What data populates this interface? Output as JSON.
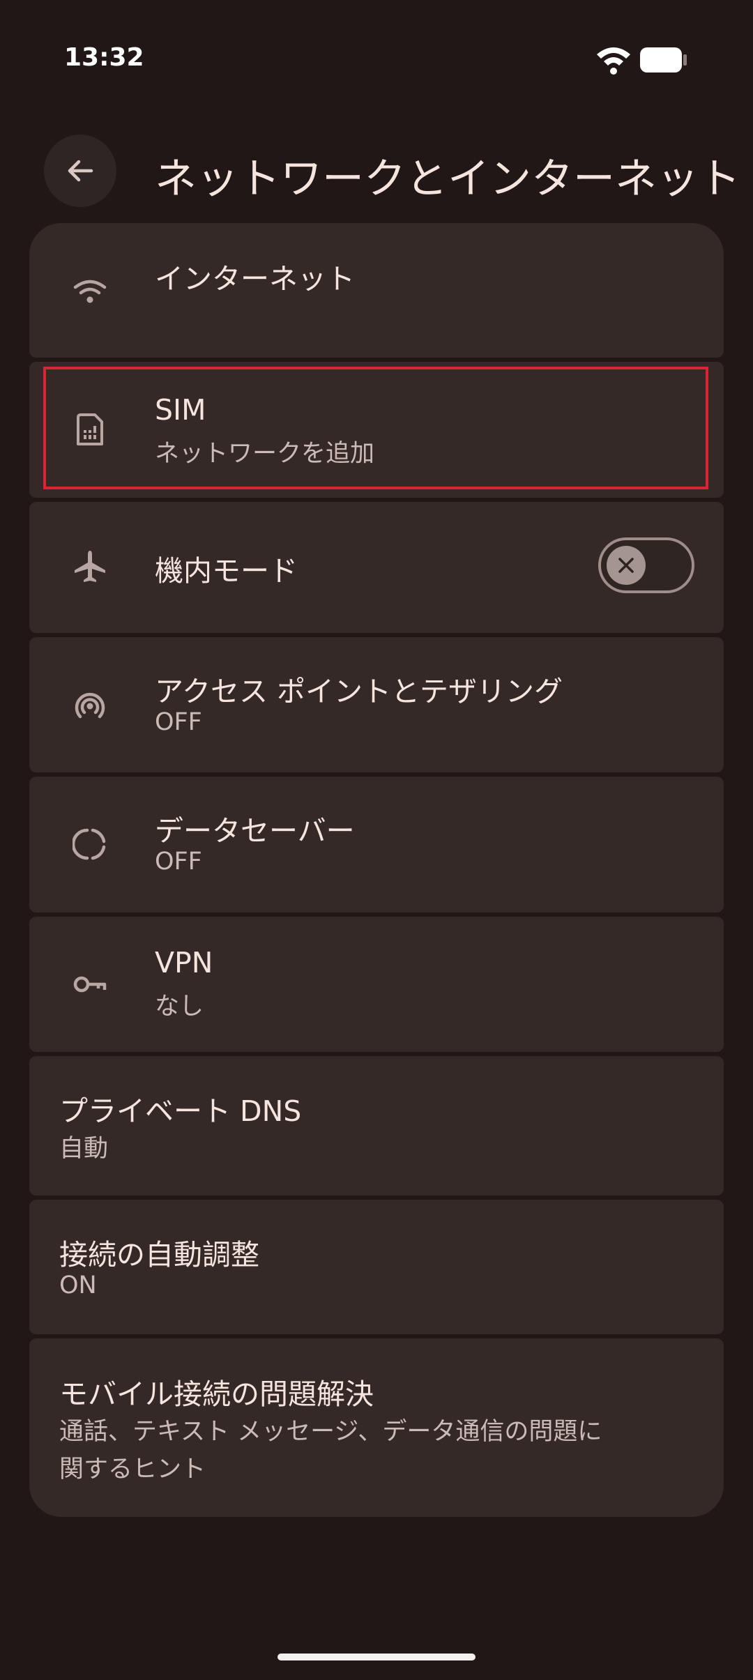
{
  "status_bar": {
    "time": "13:32"
  },
  "header": {
    "title": "ネットワークとインターネット"
  },
  "settings": [
    {
      "title": "インターネット",
      "subtitle": "",
      "icon": "wifi-icon"
    },
    {
      "title": "SIM",
      "subtitle": "ネットワークを追加",
      "icon": "sim-card-icon"
    },
    {
      "title": "機内モード",
      "subtitle": "",
      "icon": "airplane-icon",
      "toggle": "off"
    },
    {
      "title": "アクセス ポイントとテザリング",
      "subtitle": "OFF",
      "icon": "hotspot-icon"
    },
    {
      "title": "データセーバー",
      "subtitle": "OFF",
      "icon": "data-saver-icon"
    },
    {
      "title": "VPN",
      "subtitle": "なし",
      "icon": "vpn-key-icon"
    },
    {
      "title": "プライベート DNS",
      "subtitle": "自動"
    },
    {
      "title": "接続の自動調整",
      "subtitle": "ON"
    },
    {
      "title": "モバイル接続の問題解決",
      "subtitle_line1": "通話、テキスト メッセージ、データ通信の問題に",
      "subtitle_line2": "関するヒント"
    }
  ],
  "colors": {
    "background": "#201716",
    "card": "#352927",
    "highlight": "#d92531"
  }
}
